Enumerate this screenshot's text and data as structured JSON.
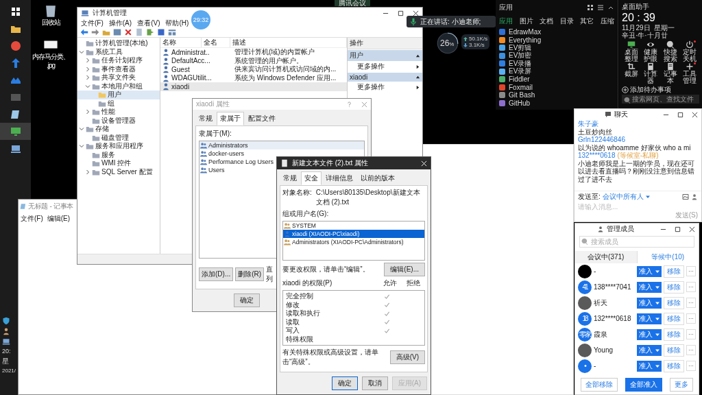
{
  "top_tab": {
    "title": "腾讯会议"
  },
  "taskbar": {
    "icons": [
      {
        "kind": "grid-logo",
        "selected": false
      },
      {
        "kind": "folder",
        "selected": false
      },
      {
        "kind": "ball",
        "selected": false
      },
      {
        "kind": "arrow",
        "selected": false
      },
      {
        "kind": "cloud",
        "selected": false
      },
      {
        "kind": "terminal",
        "selected": false
      },
      {
        "kind": "tablet",
        "selected": false
      },
      {
        "kind": "monitor",
        "selected": true
      },
      {
        "kind": "computer",
        "selected": false
      }
    ],
    "tray_icons": [
      {
        "kind": "shield"
      },
      {
        "kind": "person"
      },
      {
        "kind": "computer"
      }
    ],
    "clock": [
      "20:",
      "星",
      "2021/"
    ]
  },
  "desktop_icons": [
    {
      "kind": "recycle-bin",
      "lines": [
        "回收站"
      ]
    },
    {
      "kind": "image-file",
      "lines": [
        "内存马分类、",
        ".jpg"
      ]
    }
  ],
  "timer": "29:32",
  "notepad": {
    "title": "无标题 - 记事本",
    "menu": [
      "文件(F)",
      "编辑(E)"
    ]
  },
  "computer_management": {
    "title": "计算机管理",
    "menu": [
      "文件(F)",
      "操作(A)",
      "查看(V)",
      "帮助(H)"
    ],
    "toolbar": [
      {
        "kind": "back"
      },
      {
        "kind": "forward"
      },
      {
        "kind": "up-folder"
      },
      {
        "kind": "console"
      },
      {
        "kind": "delete"
      },
      {
        "kind": "sheet"
      },
      {
        "kind": "export"
      },
      {
        "kind": "help"
      },
      {
        "kind": "view"
      }
    ],
    "tree": [
      {
        "label": "计算机管理(本地)",
        "selected": false
      },
      {
        "label": "系统工具",
        "expanded": true,
        "selected": false,
        "children": [
          {
            "label": "任务计划程序",
            "expanded": false,
            "selected": false
          },
          {
            "label": "事件查看器",
            "expanded": false,
            "selected": false
          },
          {
            "label": "共享文件夹",
            "expanded": false,
            "selected": false
          },
          {
            "label": "本地用户和组",
            "expanded": true,
            "selected": false,
            "children": [
              {
                "label": "用户",
                "selected": true
              },
              {
                "label": "组",
                "selected": false
              }
            ]
          },
          {
            "label": "性能",
            "expanded": false,
            "selected": false
          },
          {
            "label": "设备管理器",
            "selected": false
          }
        ]
      },
      {
        "label": "存储",
        "expanded": true,
        "selected": false,
        "children": [
          {
            "label": "磁盘管理",
            "selected": false
          }
        ]
      },
      {
        "label": "服务和应用程序",
        "expanded": true,
        "selected": false,
        "children": [
          {
            "label": "服务",
            "selected": false
          },
          {
            "label": "WMI 控件",
            "selected": false
          },
          {
            "label": "SQL Server 配置",
            "expanded": false,
            "selected": false
          }
        ]
      }
    ],
    "columns": [
      "名称",
      "全名",
      "描述"
    ],
    "rows": [
      {
        "name": "Administrat..",
        "description": "管理计算机(域)的内置帐户",
        "selected": false
      },
      {
        "name": "DefaultAcc...",
        "description": "系统管理的用户帐户。",
        "selected": false
      },
      {
        "name": "Guest",
        "description": "供来宾访问计算机或访问域的内...",
        "selected": false
      },
      {
        "name": "WDAGUtilit...",
        "description": "系统为 Windows Defender 应用...",
        "selected": false
      },
      {
        "name": "xiaodi",
        "selected": true
      }
    ],
    "actions": {
      "title": "操作",
      "sections": [
        {
          "header": "用户",
          "items": [
            "更多操作"
          ]
        },
        {
          "header": "xiaodi",
          "items": [
            "更多操作"
          ]
        }
      ]
    }
  },
  "user_properties": {
    "title": "xiaodi 属性",
    "tabs": [
      {
        "label": "常规",
        "selected": false
      },
      {
        "label": "隶属于",
        "selected": true
      },
      {
        "label": "配置文件",
        "selected": false
      }
    ],
    "member_of_label": "隶属于(M):",
    "groups": [
      {
        "name": "Administrators",
        "selected": true
      },
      {
        "name": "docker-users",
        "selected": false
      },
      {
        "name": "Performance Log Users",
        "selected": false
      },
      {
        "name": "Users",
        "selected": false
      }
    ],
    "side_text": [
      "直",
      "列"
    ],
    "buttons": [
      "添加(D)...",
      "删除(R)"
    ],
    "footer_buttons": [
      "确定"
    ]
  },
  "file_properties": {
    "title": "新建文本文件 (2).txt 属性",
    "tabs": [
      {
        "label": "常规",
        "selected": false
      },
      {
        "label": "安全",
        "selected": true
      },
      {
        "label": "详细信息",
        "selected": false
      },
      {
        "label": "以前的版本",
        "selected": false
      }
    ],
    "object_label": "对象名称:",
    "object_path": "C:\\Users\\80135\\Desktop\\新建文本文档 (2).txt",
    "principals_label": "组或用户名(G):",
    "principals": [
      {
        "name": "SYSTEM",
        "kind": "group",
        "selected": false
      },
      {
        "name": "xiaodi (XIAODI-PC\\xiaodi)",
        "kind": "user",
        "selected": true
      },
      {
        "name": "Administrators (XIAODI-PC\\Administrators)",
        "kind": "group",
        "selected": false
      }
    ],
    "edit_hint": "要更改权限，请单击“编辑”。",
    "edit_button": "编辑(E)...",
    "permissions_label": "xiaodi 的权限(P)",
    "allow_label": "允许",
    "deny_label": "拒绝",
    "permissions": [
      {
        "name": "完全控制",
        "allow": true
      },
      {
        "name": "修改",
        "allow": true
      },
      {
        "name": "读取和执行",
        "allow": true
      },
      {
        "name": "读取",
        "allow": true
      },
      {
        "name": "写入",
        "allow": true
      },
      {
        "name": "特殊权限",
        "allow": false
      }
    ],
    "advanced_hint": "有关特殊权限或高级设置，请单击“高级”。",
    "advanced_button": "高级(V)",
    "footer_buttons": [
      {
        "label": "确定",
        "disabled": false
      },
      {
        "label": "取消",
        "disabled": false
      },
      {
        "label": "应用(A)",
        "disabled": true
      }
    ]
  },
  "speaking": {
    "text": "正在讲话: 小迪老师;"
  },
  "net_meter": {
    "percent": "26",
    "unit": "%",
    "level": 0.26,
    "upload": "50.1K/s",
    "download": "3.1K/s"
  },
  "apps_panel": {
    "title": "应用",
    "tabs": [
      {
        "label": "应用",
        "selected": true
      },
      {
        "label": "图片",
        "selected": false
      },
      {
        "label": "文档",
        "selected": false
      },
      {
        "label": "目录",
        "selected": false
      },
      {
        "label": "其它",
        "selected": false
      },
      {
        "label": "压缩",
        "selected": false
      }
    ],
    "apps": [
      {
        "name": "EdrawMax",
        "color": "#2f6fd6"
      },
      {
        "name": "Everything",
        "color": "#f08a24"
      },
      {
        "name": "EV剪辑",
        "color": "#4aa3e8"
      },
      {
        "name": "EV加密",
        "color": "#3d8fe0"
      },
      {
        "name": "EV录播",
        "color": "#2f7fe0"
      },
      {
        "name": "EV录屏",
        "color": "#5ab0f0"
      },
      {
        "name": "Fiddler",
        "color": "#4cae6a"
      },
      {
        "name": "Foxmail",
        "color": "#e0452c"
      },
      {
        "name": "Git Bash",
        "color": "#8a8a8a"
      },
      {
        "name": "GitHub",
        "color": "#8e6fd0"
      }
    ]
  },
  "assistant": {
    "title": "桌面助手",
    "time": "20 : 39",
    "date": "11月29日",
    "weekday": "星期一",
    "lunar": "辛丑·牛·十月廿",
    "tools": [
      {
        "label": "桌面整理",
        "kind": "monitor",
        "badge": false
      },
      {
        "label": "健康护眼",
        "kind": "eye",
        "badge": false
      },
      {
        "label": "快捷搜索",
        "kind": "search",
        "badge": false
      },
      {
        "label": "定时关机",
        "kind": "power",
        "badge": true
      },
      {
        "label": "截屏",
        "kind": "crop",
        "badge": false
      },
      {
        "label": "计算器",
        "kind": "calculator",
        "badge": false
      },
      {
        "label": "记事本",
        "kind": "note",
        "badge": false
      },
      {
        "label": "工具管理",
        "kind": "plus",
        "badge": true
      }
    ],
    "todo": "添加待办事项",
    "search_placeholder": "搜索网页、查找文件"
  },
  "chat": {
    "title": "聊天",
    "messages": [
      {
        "sender": "朱子豪",
        "text": "土豆炒肉丝"
      },
      {
        "sender": "Grln122446846",
        "text": "以为说的 whoamme  好家伙  who a mi"
      },
      {
        "sender": "132****0618",
        "tag": "(等候室-私聊)",
        "text": "小迪老师我是上一期的学员，现在还可以进去看直播吗？刚刚没注意到信息错过了进不去"
      }
    ],
    "send_to_label": "发送至:",
    "send_to": "会议中所有人",
    "placeholder": "请输入消息...",
    "send_button": "发送(S)"
  },
  "members": {
    "title": "管理成员",
    "search_placeholder": "搜索成员",
    "tabs": [
      {
        "label": "会议中(371)",
        "selected": false
      },
      {
        "label": "等候中(10)",
        "selected": true
      }
    ],
    "list": [
      {
        "name": "-",
        "kind": "dark",
        "admit": "准入",
        "remove": "移除",
        "more": "···"
      },
      {
        "name": "138****7041",
        "kind": "badge",
        "avatar_text": "41",
        "admit": "准入",
        "remove": "移除",
        "more": "···"
      },
      {
        "name": "祈天",
        "kind": "photo",
        "admit": "准入",
        "remove": "移除",
        "more": "···"
      },
      {
        "name": "132****0618",
        "kind": "badge",
        "avatar_text": "18",
        "admit": "准入",
        "remove": "移除",
        "more": "···"
      },
      {
        "name": "霞泉",
        "kind": "badge",
        "avatar_text": "零家",
        "admit": "准入",
        "remove": "移除",
        "more": "···"
      },
      {
        "name": "Young",
        "kind": "photo",
        "admit": "准入",
        "remove": "移除",
        "more": "···"
      },
      {
        "name": "-",
        "kind": "badge",
        "avatar_text": "•",
        "admit": "准入",
        "remove": "移除",
        "more": "···"
      }
    ],
    "footer_buttons": [
      "全部移除",
      "全部准入",
      "更多"
    ]
  }
}
